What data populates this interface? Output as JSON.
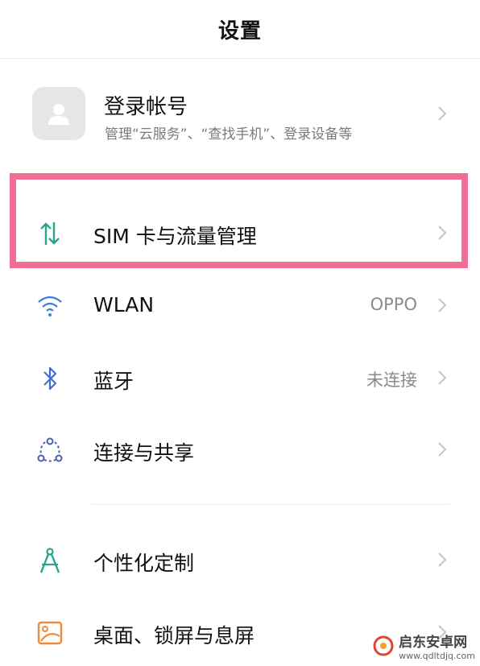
{
  "header": {
    "title": "设置"
  },
  "account": {
    "title": "登录帐号",
    "subtitle": "管理“云服务”、“查找手机”、登录设备等"
  },
  "items": [
    {
      "label": "SIM 卡与流量管理",
      "value": "",
      "icon": "arrows-updown-icon"
    },
    {
      "label": "WLAN",
      "value": "OPPO",
      "icon": "wifi-icon"
    },
    {
      "label": "蓝牙",
      "value": "未连接",
      "icon": "bluetooth-icon"
    },
    {
      "label": "连接与共享",
      "value": "",
      "icon": "share-nodes-icon"
    },
    {
      "label": "个性化定制",
      "value": "",
      "icon": "compass-icon"
    },
    {
      "label": "桌面、锁屏与息屏",
      "value": "",
      "icon": "wallpaper-icon"
    }
  ],
  "colors": {
    "highlight": "#ef6e93",
    "sim_icon": "#2aa58c",
    "wlan_icon": "#3f7ed8",
    "bluetooth_icon": "#3f6fd1",
    "share_icon": "#4a5fb0",
    "theme_icon": "#2aa58c",
    "desktop_icon": "#f08a3a"
  },
  "watermark": {
    "name": "启东安卓网",
    "url": "www.qdltdjq.com"
  }
}
